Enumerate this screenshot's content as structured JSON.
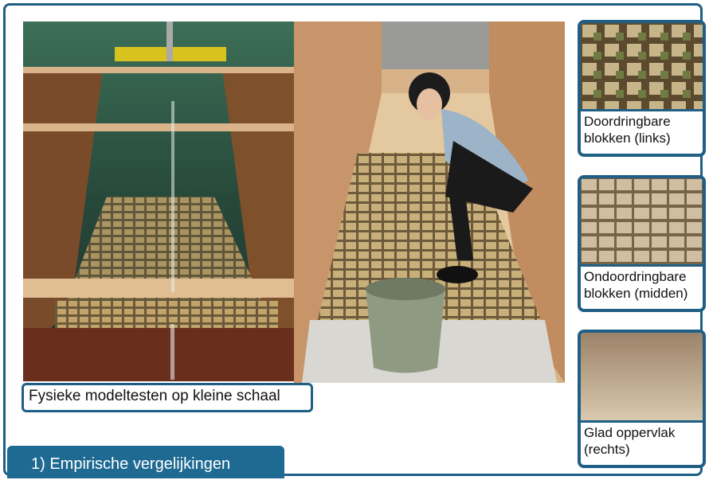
{
  "main_caption": "Fysieke modeltesten op kleine schaal",
  "section_tab": "1) Empirische vergelijkingen",
  "tiles": [
    {
      "label_line1": "Doordringbare",
      "label_line2": "blokken (links)"
    },
    {
      "label_line1": "Ondoordringbare",
      "label_line2": "blokken (midden)"
    },
    {
      "label_line1": "Glad oppervlak",
      "label_line2": "(rechts)"
    }
  ],
  "colors": {
    "accent": "#1f5f86",
    "tab_fill": "#1f6a92",
    "wood": "#b9875a",
    "water": "#2f5a46"
  }
}
